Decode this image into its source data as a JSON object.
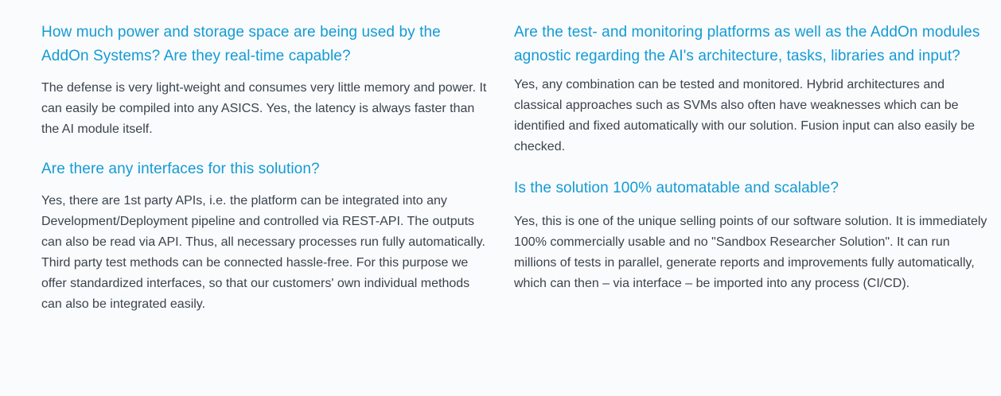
{
  "faq": {
    "left": [
      {
        "question": "How much power and storage space are being used by the AddOn Systems? Are they real-time capable?",
        "answer": "The defense is very light-weight and consumes very little memory and power. It can easily be compiled into any ASICS. Yes, the latency is always faster than the AI module itself."
      },
      {
        "question": "Are there any interfaces for this solution?",
        "answer": "Yes, there are 1st party APIs, i.e. the platform can be integrated into any Development/Deployment pipeline and controlled via REST-API. The outputs can also be read via API. Thus, all necessary processes run fully automatically. Third party test methods can be connected hassle-free. For this purpose we offer standardized interfaces, so that our customers' own individual methods can also be integrated easily."
      }
    ],
    "right": [
      {
        "question": "Are the test- and monitoring platforms as well as the AddOn modules agnostic regarding the AI's architecture, tasks, libraries and input?",
        "answer": "Yes, any combination can be tested and monitored. Hybrid architectures and classical approaches such as SVMs also often have weaknesses which can be identified and fixed automatically with our solution. Fusion input can also easily be checked."
      },
      {
        "question": "Is the solution 100% automatable and scalable?",
        "answer": "Yes, this is one of the unique selling points of our software solution. It is immediately 100% commercially usable and no \"Sandbox Researcher Solution\". It can run millions of tests in parallel, generate reports and improvements fully automatically, which can then – via interface – be imported into any process (CI/CD)."
      }
    ]
  }
}
